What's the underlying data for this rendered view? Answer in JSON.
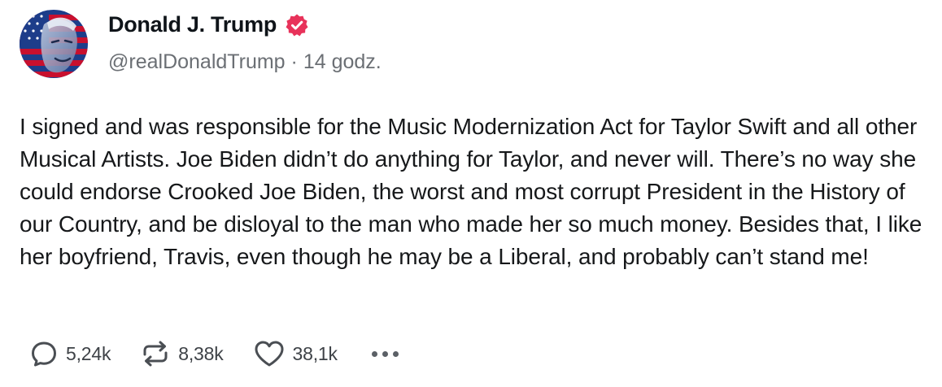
{
  "post": {
    "author_name": "Donald J. Trump",
    "handle": "@realDonaldTrump",
    "separator": "·",
    "time_ago": "14 godz.",
    "text": "I signed and was responsible for the Music Modernization Act for Taylor Swift and all other Musical Artists. Joe Biden didn’t do anything for Taylor, and never will. There’s no way she could endorse Crooked Joe Biden, the worst and most corrupt President in the History of our Country, and be disloyal to the man who made her so much money. Besides that, I like her boyfriend, Travis, even though he may be a Liberal, and probably can’t stand me!",
    "verified_badge_icon": "verified-badge-icon",
    "avatar_icon": "avatar"
  },
  "actions": {
    "replies": "5,24k",
    "reposts": "8,38k",
    "likes": "38,1k",
    "reply_icon": "reply-icon",
    "repost_icon": "repost-icon",
    "like_icon": "heart-icon",
    "more_icon": "more-icon"
  },
  "colors": {
    "badge": "#e8325a",
    "text": "#16181a",
    "muted": "#6b6f74",
    "icon": "#4a4e53"
  }
}
